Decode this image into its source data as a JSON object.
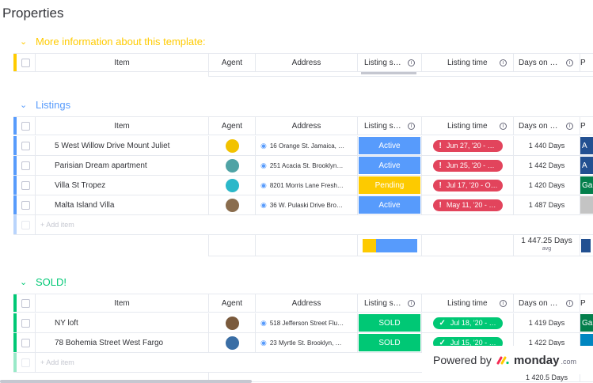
{
  "page": {
    "title": "Properties"
  },
  "columns": {
    "item": "Item",
    "agent": "Agent",
    "address": "Address",
    "listing_status": "Listing s…",
    "listing_time": "Listing time",
    "days_on": "Days on …",
    "p": "P"
  },
  "groups": {
    "info": {
      "chevron": "⌄",
      "title": "More information about this template:",
      "color": "#ffcb00"
    },
    "listings": {
      "chevron": "⌄",
      "title": "Listings",
      "color": "#579bfc",
      "rows": [
        {
          "name": "5 West Willow Drive Mount Juliet",
          "address": "16 Orange St. Jamaica, …",
          "status": "Active",
          "status_color": "#579bfc",
          "time": "Jun 27, '20 - …",
          "time_color": "#e2445c",
          "days": "1 440 Days",
          "p": "A",
          "p_color": "#225091",
          "avatar_color": "#f2c200"
        },
        {
          "name": "Parisian Dream apartment",
          "address": "251 Acacia St. Brooklyn…",
          "status": "Active",
          "status_color": "#579bfc",
          "time": "Jun 25, '20 - …",
          "time_color": "#e2445c",
          "days": "1 442 Days",
          "p": "A",
          "p_color": "#225091",
          "avatar_color": "#4fa3a5"
        },
        {
          "name": "Villa St Tropez",
          "address": "8201 Morris Lane Fresh…",
          "status": "Pending",
          "status_color": "#fdca00",
          "time": "Jul 17, '20 - O…",
          "time_color": "#e2445c",
          "days": "1 420 Days",
          "p": "Ga",
          "p_color": "#037f4c",
          "avatar_color": "#2bb8c9"
        },
        {
          "name": "Malta Island Villa",
          "address": "36 W. Pulaski Drive Bro…",
          "status": "Active",
          "status_color": "#579bfc",
          "time": "May 11, '20 - …",
          "time_color": "#e2445c",
          "days": "1 487 Days",
          "p": "",
          "p_color": "#c4c4c4",
          "avatar_color": "#8a6d4e"
        }
      ],
      "add_item": "+ Add item",
      "summary": {
        "days": "1 447.25 Days",
        "agg": "avg",
        "yellow_share": 0.25,
        "blue_share": 0.75
      }
    },
    "sold": {
      "chevron": "⌄",
      "title": "SOLD!",
      "color": "#00c875",
      "rows": [
        {
          "name": "NY loft",
          "address": "518 Jefferson Street Flu…",
          "status": "SOLD",
          "status_color": "#00c875",
          "time": "Jul 18, '20 - …",
          "time_color": "#00c875",
          "days": "1 419 Days",
          "p": "Ga",
          "p_color": "#037f4c",
          "avatar_color": "#7a5a3c"
        },
        {
          "name": "78 Bohemia Street West Fargo",
          "address": "23 Myrtle St. Brooklyn, …",
          "status": "SOLD",
          "status_color": "#00c875",
          "time": "Jul 15, '20 - …",
          "time_color": "#00c875",
          "days": "1 422 Days",
          "p": "",
          "p_color": "#0086c0",
          "avatar_color": "#3a6ea5"
        }
      ],
      "add_item": "+ Add item",
      "summary": {
        "days": "1 420.5 Days"
      }
    }
  },
  "powered_by": {
    "label": "Powered by",
    "brand": "monday",
    "suffix": ".com"
  }
}
